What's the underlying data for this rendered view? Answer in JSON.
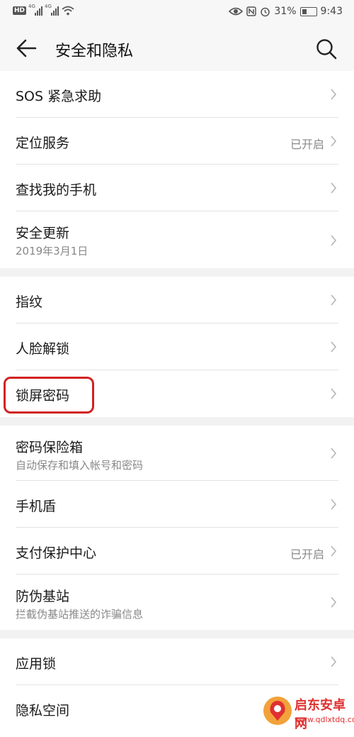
{
  "status_bar": {
    "hd": "HD",
    "net1": "4G",
    "net2": "4G",
    "battery": "31%",
    "time": "9:43"
  },
  "header": {
    "title": "安全和隐私"
  },
  "groups": [
    {
      "items": [
        {
          "label": "SOS 紧急求助"
        },
        {
          "label": "定位服务",
          "value": "已开启"
        },
        {
          "label": "查找我的手机"
        },
        {
          "label": "安全更新",
          "sub": "2019年3月1日"
        }
      ]
    },
    {
      "items": [
        {
          "label": "指纹"
        },
        {
          "label": "人脸解锁"
        },
        {
          "label": "锁屏密码",
          "highlighted": true
        }
      ]
    },
    {
      "items": [
        {
          "label": "密码保险箱",
          "sub": "自动保存和填入帐号和密码"
        },
        {
          "label": "手机盾"
        },
        {
          "label": "支付保护中心",
          "value": "已开启"
        },
        {
          "label": "防伪基站",
          "sub": "拦截伪基站推送的诈骗信息"
        }
      ]
    },
    {
      "items": [
        {
          "label": "应用锁"
        },
        {
          "label": "隐私空间"
        }
      ]
    }
  ],
  "watermark": {
    "title": "启东安卓网",
    "url": "www.qdlxtdq.com"
  },
  "colors": {
    "highlight": "#d12222",
    "background": "#f2f2f2",
    "watermark": "#e03030"
  }
}
